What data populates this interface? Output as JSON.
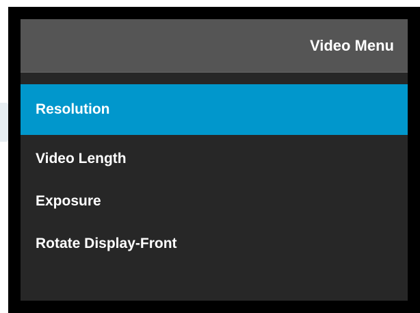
{
  "header": {
    "title": "Video Menu"
  },
  "menu": {
    "items": [
      {
        "label": "Resolution",
        "selected": true
      },
      {
        "label": "Video Length",
        "selected": false
      },
      {
        "label": "Exposure",
        "selected": false
      },
      {
        "label": "Rotate Display-Front",
        "selected": false
      }
    ]
  },
  "colors": {
    "frame": "#000000",
    "header_background": "#555555",
    "screen_background": "#272727",
    "selection_highlight": "#0197cc",
    "text": "#ffffff"
  }
}
